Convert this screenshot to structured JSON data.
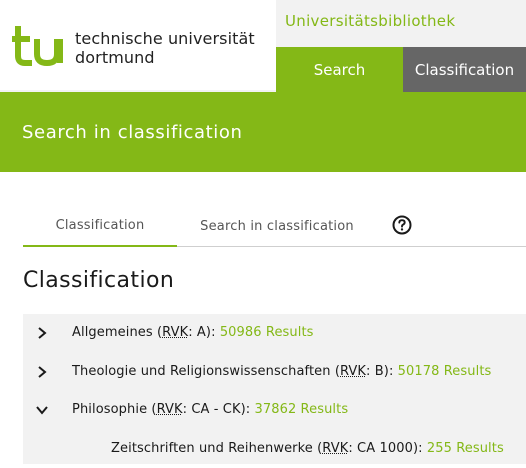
{
  "header": {
    "logo_line1": "technische universität",
    "logo_line2": "dortmund",
    "library_title": "Universitätsbibliothek",
    "nav": [
      {
        "label": "Search"
      },
      {
        "label": "Classification"
      }
    ]
  },
  "banner": {
    "title": "Search in classification"
  },
  "tabs": [
    {
      "label": "Classification",
      "active": true
    },
    {
      "label": "Search in classification",
      "active": false
    }
  ],
  "help_icon": "question-circle-icon",
  "section_title": "Classification",
  "tree": [
    {
      "name": "Allgemeines",
      "abbr": "RVK",
      "code": ": A):",
      "results": "50986 Results",
      "expanded": false,
      "icon": "chevron-right-icon"
    },
    {
      "name": "Theologie und Religionswissenschaften",
      "abbr": "RVK",
      "code": ": B):",
      "results": "50178 Results",
      "expanded": false,
      "icon": "chevron-right-icon"
    },
    {
      "name": "Philosophie",
      "abbr": "RVK",
      "code": ": CA - CK):",
      "results": "37862 Results",
      "expanded": true,
      "icon": "chevron-down-icon"
    },
    {
      "name": "Zeitschriften und Reihenwerke",
      "abbr": "RVK",
      "code": ": CA 1000):",
      "results": "255 Results",
      "expanded": false
    }
  ],
  "colors": {
    "accent": "#84b817",
    "nav_dark": "#666666",
    "tree_bg": "#f2f2f2"
  }
}
